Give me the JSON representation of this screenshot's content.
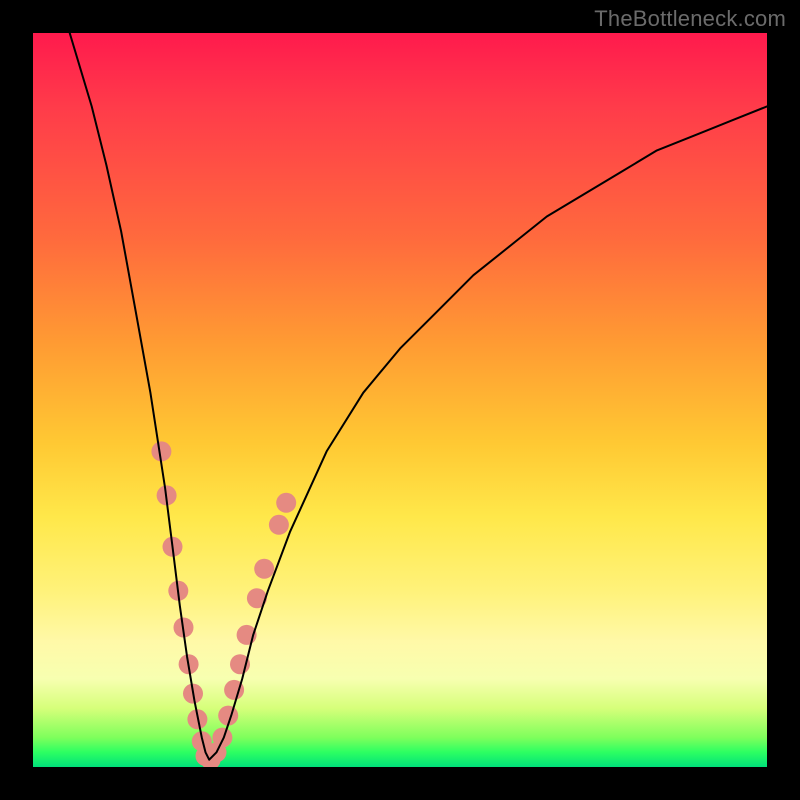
{
  "watermark": {
    "text": "TheBottleneck.com"
  },
  "chart_data": {
    "type": "line",
    "title": "",
    "xlabel": "",
    "ylabel": "",
    "xlim": [
      0,
      100
    ],
    "ylim": [
      0,
      100
    ],
    "grid": false,
    "legend": false,
    "background_gradient": {
      "direction": "vertical",
      "stops": [
        {
          "pos": 0.0,
          "color": "#ff1a4d"
        },
        {
          "pos": 0.4,
          "color": "#ff8a33"
        },
        {
          "pos": 0.7,
          "color": "#ffe84a"
        },
        {
          "pos": 0.9,
          "color": "#d6ff7a"
        },
        {
          "pos": 1.0,
          "color": "#00e07a"
        }
      ]
    },
    "series": [
      {
        "name": "bottleneck-curve",
        "color": "#000000",
        "stroke_width": 2,
        "x": [
          5,
          8,
          10,
          12,
          14,
          16,
          18,
          19,
          20,
          21,
          22,
          23,
          23.5,
          24,
          25,
          26,
          27,
          28.5,
          30,
          32,
          35,
          40,
          45,
          50,
          55,
          60,
          65,
          70,
          75,
          80,
          85,
          90,
          95,
          100
        ],
        "y": [
          100,
          90,
          82,
          73,
          62,
          51,
          38,
          30,
          22,
          15,
          9,
          4,
          2,
          1,
          2,
          4,
          7,
          12,
          18,
          24,
          32,
          43,
          51,
          57,
          62,
          67,
          71,
          75,
          78,
          81,
          84,
          86,
          88,
          90
        ]
      }
    ],
    "highlighted_points": {
      "name": "salmon-dots",
      "color": "#e58a82",
      "radius": 10,
      "points": [
        {
          "x": 17.5,
          "y": 43
        },
        {
          "x": 18.2,
          "y": 37
        },
        {
          "x": 19.0,
          "y": 30
        },
        {
          "x": 19.8,
          "y": 24
        },
        {
          "x": 20.5,
          "y": 19
        },
        {
          "x": 21.2,
          "y": 14
        },
        {
          "x": 21.8,
          "y": 10
        },
        {
          "x": 22.4,
          "y": 6.5
        },
        {
          "x": 23.0,
          "y": 3.5
        },
        {
          "x": 23.5,
          "y": 1.5
        },
        {
          "x": 24.2,
          "y": 1.0
        },
        {
          "x": 25.0,
          "y": 2.0
        },
        {
          "x": 25.8,
          "y": 4.0
        },
        {
          "x": 26.6,
          "y": 7.0
        },
        {
          "x": 27.4,
          "y": 10.5
        },
        {
          "x": 28.2,
          "y": 14
        },
        {
          "x": 29.1,
          "y": 18
        },
        {
          "x": 30.5,
          "y": 23
        },
        {
          "x": 31.5,
          "y": 27
        },
        {
          "x": 33.5,
          "y": 33
        },
        {
          "x": 34.5,
          "y": 36
        }
      ]
    }
  }
}
